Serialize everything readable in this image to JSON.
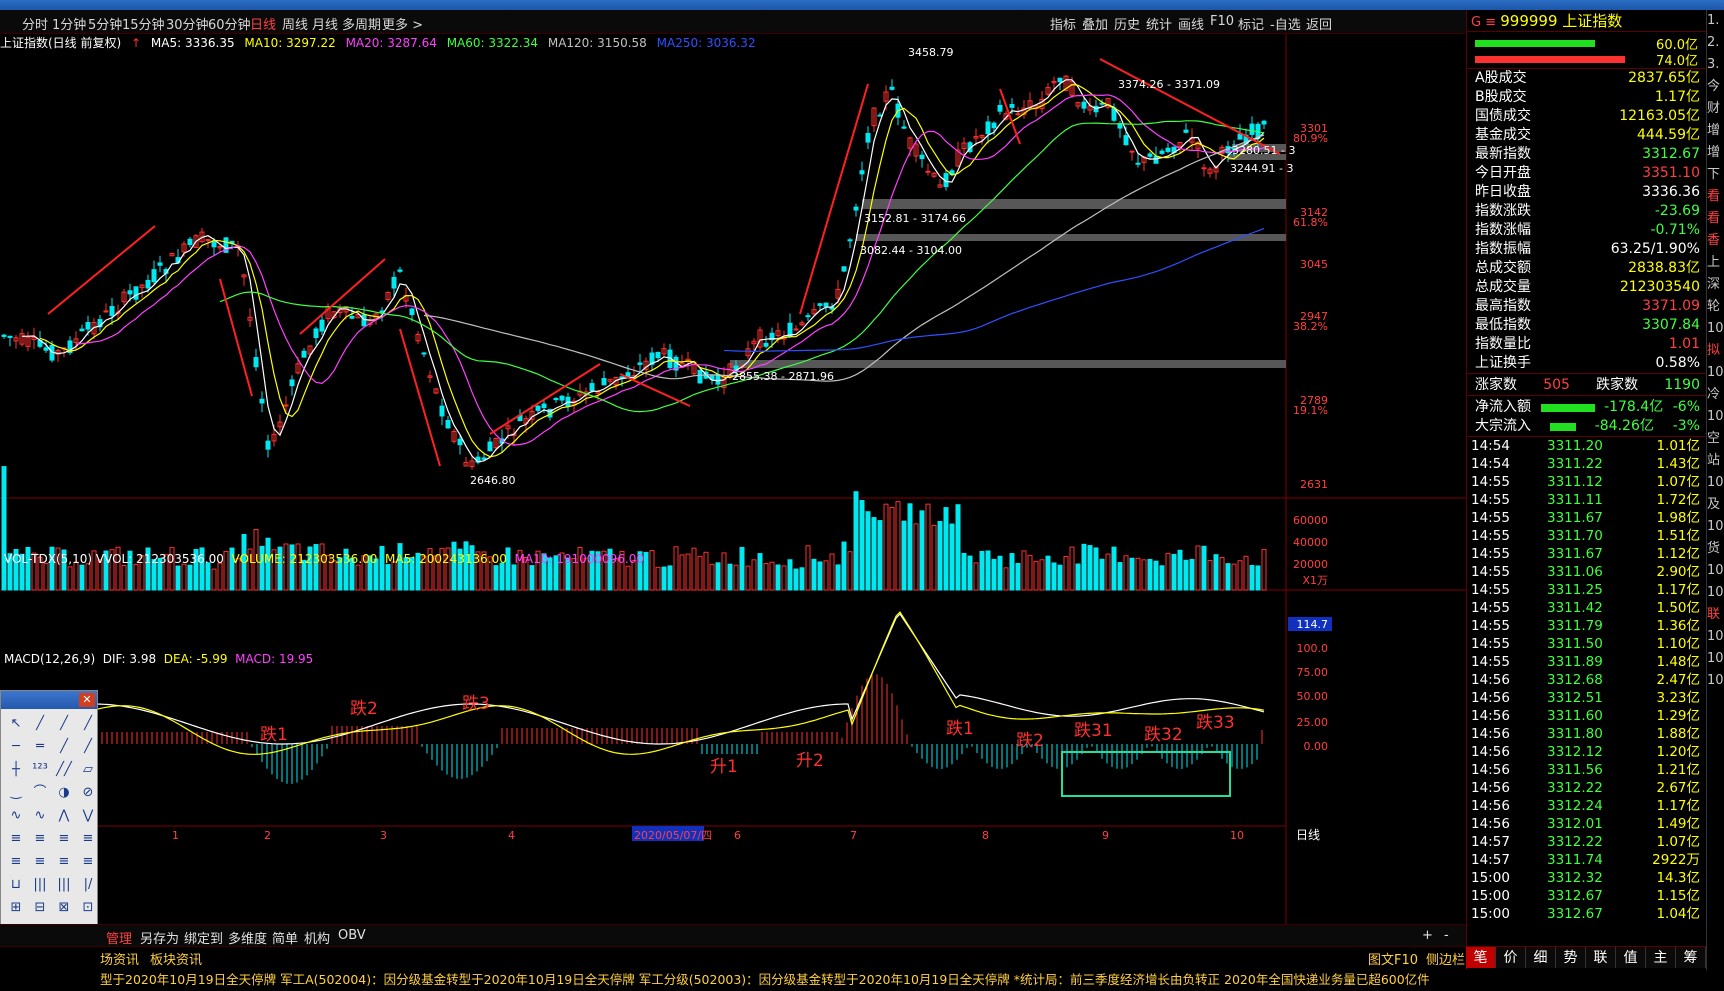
{
  "toolbar": {
    "periods": [
      "分时",
      "1分钟",
      "5分钟",
      "15分钟",
      "30分钟",
      "60分钟",
      "日线",
      "周线",
      "月线",
      "多周期",
      "更多 >"
    ],
    "active_period": "日线",
    "right_items": [
      "指标",
      "叠加",
      "历史",
      "统计",
      "画线",
      "F10",
      "标记",
      "-自选",
      "返回"
    ]
  },
  "ma_line": {
    "title": "上证指数(日线 前复权)",
    "ma5": "MA5: 3336.35",
    "ma10": "MA10: 3297.22",
    "ma20": "MA20: 3287.64",
    "ma60": "MA60: 3322.34",
    "ma120": "MA120: 3150.58",
    "ma250": "MA250: 3036.32"
  },
  "price_labels": {
    "high": "3458.79",
    "low": "2646.80",
    "range1": "3374.26 - 3371.09",
    "range2": "3280.51 - 3",
    "range3": "3244.91 - 3",
    "range4": "3152.81 - 3174.66",
    "range5": "3082.44 - 3104.00",
    "range6": "2855.38 - 2871.96"
  },
  "price_axis": [
    "3301",
    "80.9%",
    "3142",
    "61.8%",
    "3045",
    "2947",
    "38.2%",
    "2789",
    "19.1%",
    "2631"
  ],
  "vol_line": {
    "label": "VOL-TDX(5,10)",
    "vvol": "VVOL: 212303536.00",
    "volume": "VOLUME: 212303536.00",
    "ma5": "MA5: 200243136.00",
    "ma10": "MA10: 191000096.00"
  },
  "vol_axis": [
    "60000",
    "40000",
    "20000",
    "X1万"
  ],
  "macd_line": {
    "label": "MACD(12,26,9)",
    "dif": "DIF: 3.98",
    "dea": "DEA: -5.99",
    "macd": "MACD: 19.95"
  },
  "macd_axis": [
    "114.7",
    "100.0",
    "75.00",
    "50.00",
    "25.00",
    "0.00"
  ],
  "annotations": [
    "跌1",
    "跌2",
    "跌3",
    "升1",
    "升2",
    "跌1",
    "跌2",
    "跌31",
    "跌32",
    "跌33"
  ],
  "x_axis": [
    "1",
    "2",
    "3",
    "4",
    "2020/05/07/四",
    "6",
    "7",
    "8",
    "9",
    "10"
  ],
  "bottom_tabs": [
    "管理",
    "另存为",
    "绑定到",
    "多维度",
    "简单",
    "机构",
    "OBV"
  ],
  "right_of_bottom": "日线",
  "news_tabs": [
    "场资讯",
    "板块资讯"
  ],
  "news_right": [
    "图文F10",
    "侧边栏"
  ],
  "news_ticker": "型于2020年10月19日全天停牌        军工A(502004)：因分级基金转型于2020年10月19日全天停牌        军工分级(502003)：因分级基金转型于2020年10月19日全天停牌        *统计局：前三季度经济增长由负转正        2020年全国快递业务量已超600亿件",
  "quote": {
    "code": "999999",
    "name": "上证指数",
    "bar1_pct": "60.0亿",
    "bar2_pct": "74.0亿",
    "rows": [
      {
        "label": "A股成交",
        "value": "2837.65亿",
        "color": "#ffff00"
      },
      {
        "label": "B股成交",
        "value": "1.17亿",
        "color": "#ffff00"
      },
      {
        "label": "国债成交",
        "value": "12163.05亿",
        "color": "#ffff00"
      },
      {
        "label": "基金成交",
        "value": "444.59亿",
        "color": "#ffff00"
      },
      {
        "label": "最新指数",
        "value": "3312.67",
        "color": "#40ff40"
      },
      {
        "label": "今日开盘",
        "value": "3351.10",
        "color": "#ff4040"
      },
      {
        "label": "昨日收盘",
        "value": "3336.36",
        "color": "#ffffff"
      },
      {
        "label": "指数涨跌",
        "value": "-23.69",
        "color": "#40ff40"
      },
      {
        "label": "指数涨幅",
        "value": "-0.71%",
        "color": "#40ff40"
      },
      {
        "label": "指数振幅",
        "value": "63.25/1.90%",
        "color": "#ffffff"
      },
      {
        "label": "总成交额",
        "value": "2838.83亿",
        "color": "#ffff00"
      },
      {
        "label": "总成交量",
        "value": "212303540",
        "color": "#ffff00"
      },
      {
        "label": "最高指数",
        "value": "3371.09",
        "color": "#ff4040"
      },
      {
        "label": "最低指数",
        "value": "3307.84",
        "color": "#40ff40"
      },
      {
        "label": "指数量比",
        "value": "1.01",
        "color": "#ff4040"
      },
      {
        "label": "上证换手",
        "value": "0.58%",
        "color": "#ffffff"
      }
    ],
    "up_count_label": "涨家数",
    "up_count": "505",
    "down_count_label": "跌家数",
    "down_count": "1190",
    "netflow_label": "净流入额",
    "netflow": "-178.4亿",
    "netflow_pct": "-6%",
    "bigflow_label": "大宗流入",
    "bigflow": "-84.26亿",
    "bigflow_pct": "-3%"
  },
  "ticks": [
    [
      "14:54",
      "3311.20",
      "1.01亿"
    ],
    [
      "14:54",
      "3311.22",
      "1.43亿"
    ],
    [
      "14:55",
      "3311.12",
      "1.07亿"
    ],
    [
      "14:55",
      "3311.11",
      "1.72亿"
    ],
    [
      "14:55",
      "3311.67",
      "1.98亿"
    ],
    [
      "14:55",
      "3311.70",
      "1.51亿"
    ],
    [
      "14:55",
      "3311.67",
      "1.12亿"
    ],
    [
      "14:55",
      "3311.06",
      "2.90亿"
    ],
    [
      "14:55",
      "3311.25",
      "1.17亿"
    ],
    [
      "14:55",
      "3311.42",
      "1.50亿"
    ],
    [
      "14:55",
      "3311.79",
      "1.36亿"
    ],
    [
      "14:55",
      "3311.50",
      "1.10亿"
    ],
    [
      "14:55",
      "3311.89",
      "1.48亿"
    ],
    [
      "14:56",
      "3312.68",
      "2.47亿"
    ],
    [
      "14:56",
      "3312.51",
      "3.23亿"
    ],
    [
      "14:56",
      "3311.60",
      "1.29亿"
    ],
    [
      "14:56",
      "3311.80",
      "1.88亿"
    ],
    [
      "14:56",
      "3312.12",
      "1.20亿"
    ],
    [
      "14:56",
      "3311.56",
      "1.21亿"
    ],
    [
      "14:56",
      "3312.22",
      "2.67亿"
    ],
    [
      "14:56",
      "3312.24",
      "1.17亿"
    ],
    [
      "14:56",
      "3312.01",
      "1.49亿"
    ],
    [
      "14:57",
      "3312.22",
      "1.07亿"
    ],
    [
      "14:57",
      "3311.74",
      "2922万"
    ],
    [
      "15:00",
      "3312.32",
      "14.3亿"
    ],
    [
      "15:00",
      "3312.67",
      "1.15亿"
    ],
    [
      "15:00",
      "3312.67",
      "1.04亿"
    ]
  ],
  "panel_tabs": [
    "笔",
    "价",
    "细",
    "势",
    "联",
    "值",
    "主",
    "筹"
  ],
  "far_right": [
    "1.",
    "2.",
    "3.",
    "今",
    "财",
    "增",
    "增",
    "下",
    "看",
    "看",
    "香",
    "上",
    "深",
    "轮",
    "10",
    "拟",
    "10",
    "冷",
    "10",
    "空",
    "站",
    "10",
    "及",
    "10",
    "货",
    "10",
    "10",
    "联",
    "10",
    "10",
    "10"
  ]
}
